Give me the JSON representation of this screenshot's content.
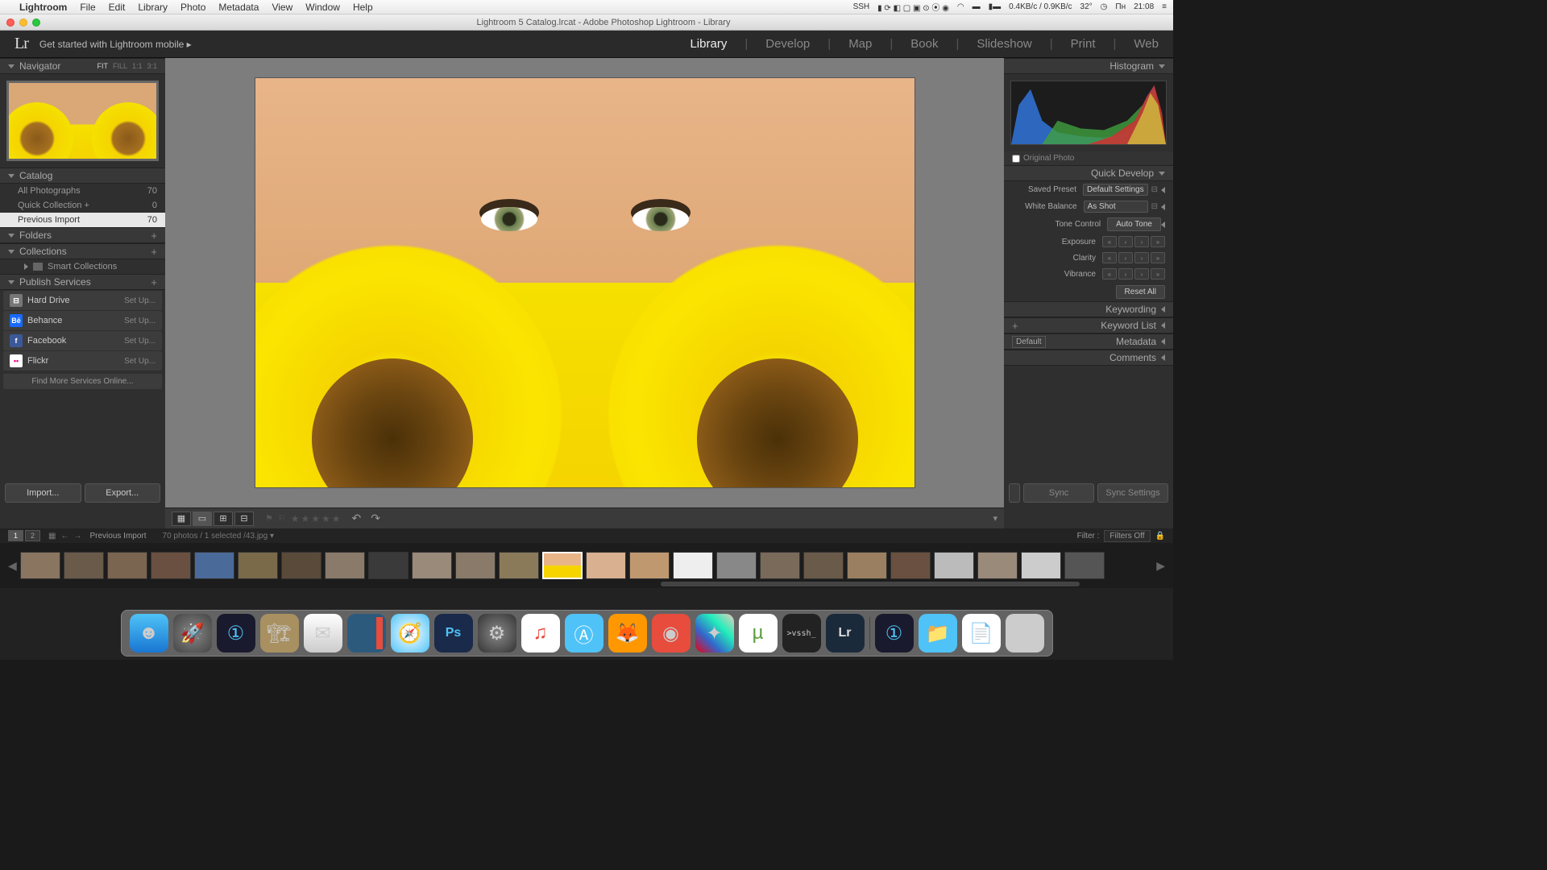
{
  "mac_menu": {
    "app": "Lightroom",
    "items": [
      "File",
      "Edit",
      "Library",
      "Photo",
      "Metadata",
      "View",
      "Window",
      "Help"
    ],
    "right": {
      "ssh": "SSH",
      "net": "0.4KB/c / 0.9KB/c",
      "temp": "32°",
      "day": "Пн",
      "time": "21:08"
    }
  },
  "window_title": "Lightroom 5 Catalog.lrcat - Adobe Photoshop Lightroom - Library",
  "lr_top": {
    "logo": "Lr",
    "get_started": "Get started with Lightroom mobile  ▸",
    "modules": [
      "Library",
      "Develop",
      "Map",
      "Book",
      "Slideshow",
      "Print",
      "Web"
    ],
    "active_module": "Library"
  },
  "navigator": {
    "title": "Navigator",
    "opts": [
      "FIT",
      "FILL",
      "1:1",
      "3:1"
    ],
    "selected": "FIT"
  },
  "catalog": {
    "title": "Catalog",
    "rows": [
      {
        "label": "All Photographs",
        "count": "70"
      },
      {
        "label": "Quick Collection  +",
        "count": "0"
      },
      {
        "label": "Previous Import",
        "count": "70",
        "sel": true
      }
    ]
  },
  "folders": {
    "title": "Folders"
  },
  "collections": {
    "title": "Collections",
    "smart": "Smart Collections"
  },
  "publish": {
    "title": "Publish Services",
    "rows": [
      {
        "name": "Hard Drive",
        "setup": "Set Up...",
        "cls": "pub-hd",
        "icon": "⊟"
      },
      {
        "name": "Behance",
        "setup": "Set Up...",
        "cls": "pub-be",
        "icon": "Bē"
      },
      {
        "name": "Facebook",
        "setup": "Set Up...",
        "cls": "pub-fb",
        "icon": "f"
      },
      {
        "name": "Flickr",
        "setup": "Set Up...",
        "cls": "pub-fl",
        "icon": "••"
      }
    ],
    "find": "Find More Services Online..."
  },
  "left_buttons": {
    "import": "Import...",
    "export": "Export..."
  },
  "histogram": {
    "title": "Histogram",
    "orig": "Original Photo"
  },
  "quick_develop": {
    "title": "Quick Develop",
    "saved_preset": {
      "lbl": "Saved Preset",
      "val": "Default Settings"
    },
    "white_balance": {
      "lbl": "White Balance",
      "val": "As Shot"
    },
    "tone": {
      "lbl": "Tone Control",
      "btn": "Auto Tone"
    },
    "exposure": "Exposure",
    "clarity": "Clarity",
    "vibrance": "Vibrance",
    "reset": "Reset All"
  },
  "keywording": {
    "title": "Keywording"
  },
  "keyword_list": {
    "title": "Keyword List"
  },
  "metadata": {
    "title": "Metadata",
    "sel": "Default"
  },
  "comments": {
    "title": "Comments"
  },
  "right_buttons": {
    "sync": "Sync",
    "sync_settings": "Sync Settings"
  },
  "filter_bar": {
    "prev_import": "Previous Import",
    "info": "70 photos / 1 selected /43.jpg ▾",
    "filter_lbl": "Filter :",
    "filters_off": "Filters Off"
  },
  "filmstrip_count": 25,
  "filmstrip_selected": 12
}
